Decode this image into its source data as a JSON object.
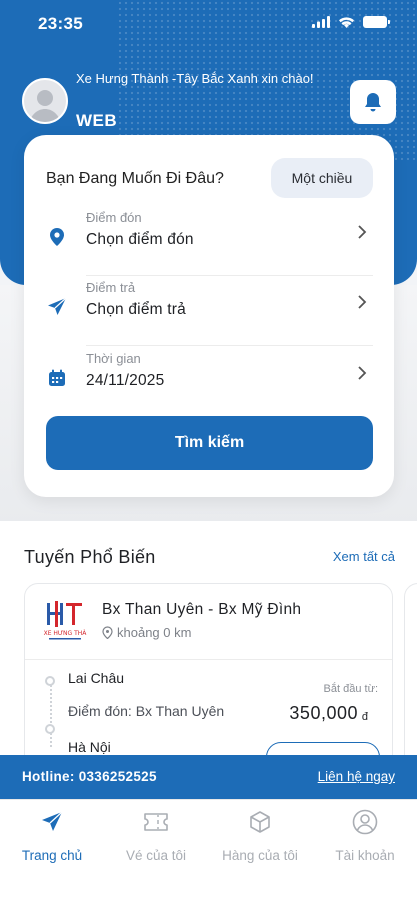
{
  "status_bar": {
    "time": "23:35"
  },
  "header": {
    "greeting": "Xe Hưng Thành -Tây Bắc Xanh xin chào!",
    "user_name": "WEB"
  },
  "search_card": {
    "title": "Bạn Đang Muốn Đi Đâu?",
    "trip_type": "Một chiều",
    "pickup": {
      "label": "Điểm đón",
      "value": "Chọn điểm đón"
    },
    "dropoff": {
      "label": "Điểm trả",
      "value": "Chọn điểm trả"
    },
    "date": {
      "label": "Thời gian",
      "value": "24/11/2025"
    },
    "search_label": "Tìm kiếm"
  },
  "popular": {
    "title": "Tuyến Phổ Biến",
    "see_all": "Xem tất cả",
    "route": {
      "logo_text": "XE HƯNG THÀ",
      "name": "Bx Than Uyên - Bx Mỹ Đình",
      "distance": "khoảng 0 km",
      "from_city": "Lai Châu",
      "pickup": "Điểm đón: Bx Than Uyên",
      "to_city": "Hà Nội",
      "start_label": "Bắt đầu từ:",
      "price": "350,000",
      "currency": "đ"
    }
  },
  "hotline": {
    "text": "Hotline: 0336252525",
    "contact": "Liên hệ ngay"
  },
  "tabs": [
    {
      "label": "Trang chủ",
      "icon": "send-icon",
      "active": true
    },
    {
      "label": "Vé của tôi",
      "icon": "ticket-icon",
      "active": false
    },
    {
      "label": "Hàng của tôi",
      "icon": "package-icon",
      "active": false
    },
    {
      "label": "Tài khoản",
      "icon": "user-icon",
      "active": false
    }
  ],
  "colors": {
    "primary": "#1d6cb7",
    "background": "#f2f4f7",
    "inactive": "#a9adb3"
  }
}
